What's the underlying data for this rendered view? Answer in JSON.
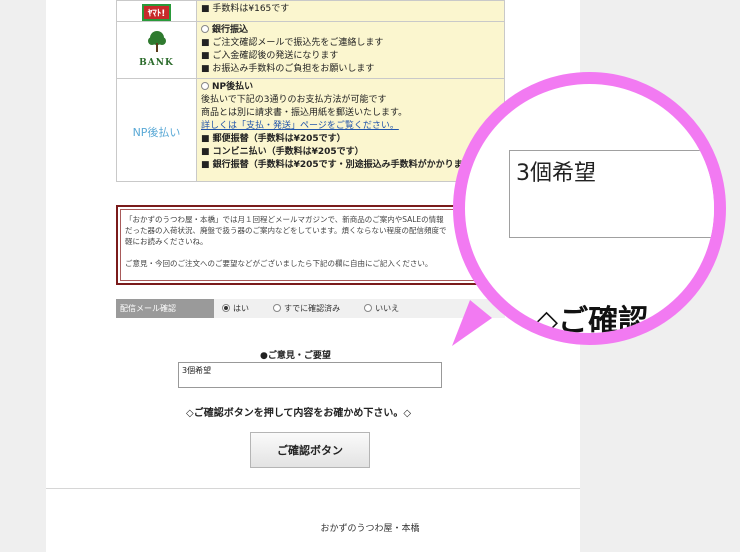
{
  "payment": {
    "cod": {
      "fee_text": "■ 手数料は¥165です",
      "logo_text": "ﾔﾏﾄ!"
    },
    "bank": {
      "logo_text": "BANK",
      "title": "銀行振込",
      "lines": [
        "■ ご注文確認メールで振込先をご連絡します",
        "■ ご入金確認後の発送になります",
        "■ お振込み手数料のご負担をお願いします"
      ]
    },
    "np": {
      "logo_text": "NP後払い",
      "title": "NP後払い",
      "line1": "後払いで下記の3通りのお支払方法が可能です",
      "line2": "商品とは別に請求書・振込用紙を郵送いたします。",
      "link": "詳しくは「支払・発送」ページをご覧ください。",
      "opt1": "■ 郵便振替（手数料は¥205です）",
      "opt2": "■ コンビニ払い（手数料は¥205です）",
      "opt3": "■ 銀行振替（手数料は¥205です・別途振込み手数料がかかります）"
    }
  },
  "notice": {
    "line1": "「おかずのうつわ屋・本橋」では月１回程どメールマガジンで、新商品のご案内やSALEの情報",
    "line2": "だった器の入荷状況、廃盤で扱う器のご案内などをしています。煩くならない程度の配信頻度で",
    "line3": "軽にお読みくださいね。",
    "line4": "ご意見・今回のご注文へのご要望などがございましたら下記の欄に自由にご記入ください。"
  },
  "mailmag": {
    "label": "配信メール確認",
    "options": [
      "はい",
      "すでに確認済み",
      "いいえ"
    ]
  },
  "request": {
    "title": "●ご意見・ご要望",
    "value": "3個希望"
  },
  "guide_text": "◇ご確認ボタンを押して内容をお確かめ下さい。◇",
  "confirm_button": "ご確認ボタン",
  "footer": "おかずのうつわ屋・本橋",
  "magnifier": {
    "box_value": "3個希望",
    "text": "◇ご確認"
  }
}
